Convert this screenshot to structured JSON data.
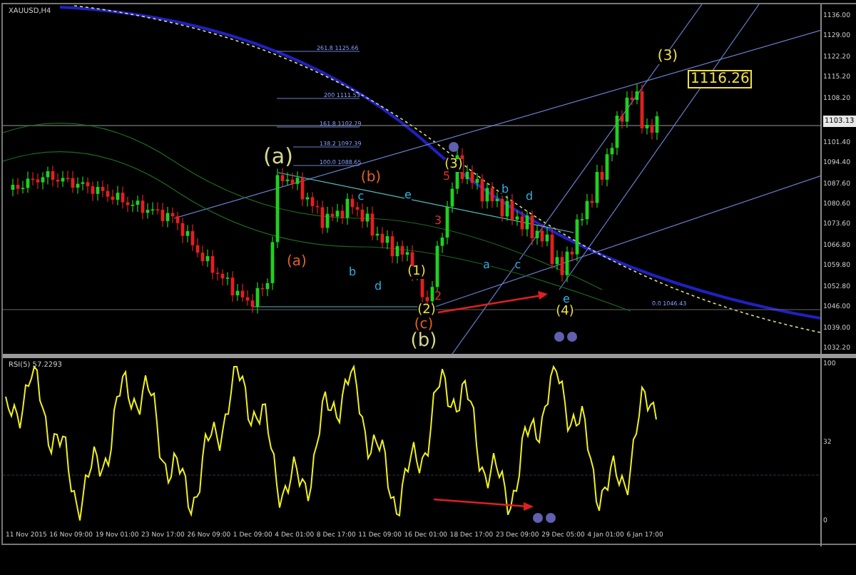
{
  "chart": {
    "title": "XAUUSD,H4",
    "price_axis": [
      "1136.00",
      "1129.00",
      "1122.20",
      "1115.20",
      "1108.20",
      "1101.40",
      "1094.40",
      "1087.60",
      "1080.60",
      "1073.60",
      "1066.80",
      "1059.80",
      "1052.80",
      "1046.00",
      "1039.00",
      "1032.20"
    ],
    "current_price": "1103.13",
    "price_tag": "1116.26",
    "fib_levels": [
      "261.8 1125.66",
      "200 1111.53",
      "161.8 1102.79",
      "138.2 1097.39",
      "100.0 1088.65",
      "0.0 1046.43"
    ],
    "wave_labels": [
      {
        "text": "(a)",
        "color": "#d8d88c"
      },
      {
        "text": "(b)",
        "color": "#e0602a"
      },
      {
        "text": "(a)",
        "color": "#e0602a"
      },
      {
        "text": "(c)",
        "color": "#e0602a"
      },
      {
        "text": "(b)",
        "color": "#d8d88c"
      },
      {
        "text": "(3)",
        "color": "#f0e040"
      },
      {
        "text": "(3)",
        "color": "#f0e040"
      },
      {
        "text": "(1)",
        "color": "#f0e040"
      },
      {
        "text": "(2)",
        "color": "#f0e040"
      },
      {
        "text": "(4)",
        "color": "#f0e040"
      },
      {
        "text": "c",
        "color": "#30b0e0"
      },
      {
        "text": "e",
        "color": "#30b0e0"
      },
      {
        "text": "b",
        "color": "#30b0e0"
      },
      {
        "text": "d",
        "color": "#30b0e0"
      },
      {
        "text": "a",
        "color": "#30b0e0"
      },
      {
        "text": "c",
        "color": "#30b0e0"
      },
      {
        "text": "b",
        "color": "#30b0e0"
      },
      {
        "text": "d",
        "color": "#30b0e0"
      },
      {
        "text": "e",
        "color": "#30b0e0"
      },
      {
        "text": "5",
        "color": "#e03030"
      },
      {
        "text": "3",
        "color": "#e03030"
      },
      {
        "text": "2",
        "color": "#e03030"
      }
    ]
  },
  "rsi": {
    "title": "RSI(5) 57.2293",
    "scale": [
      "100",
      "32",
      "0"
    ]
  },
  "time_axis": [
    "11 Nov 2015",
    "16 Nov 09:00",
    "19 Nov 01:00",
    "23 Nov 17:00",
    "26 Nov 09:00",
    "1 Dec 09:00",
    "4 Dec 01:00",
    "8 Dec 17:00",
    "11 Dec 09:00",
    "16 Dec 01:00",
    "18 Dec 17:00",
    "23 Dec 09:00",
    "29 Dec 05:00",
    "4 Jan 01:00",
    "6 Jan 17:00"
  ]
}
